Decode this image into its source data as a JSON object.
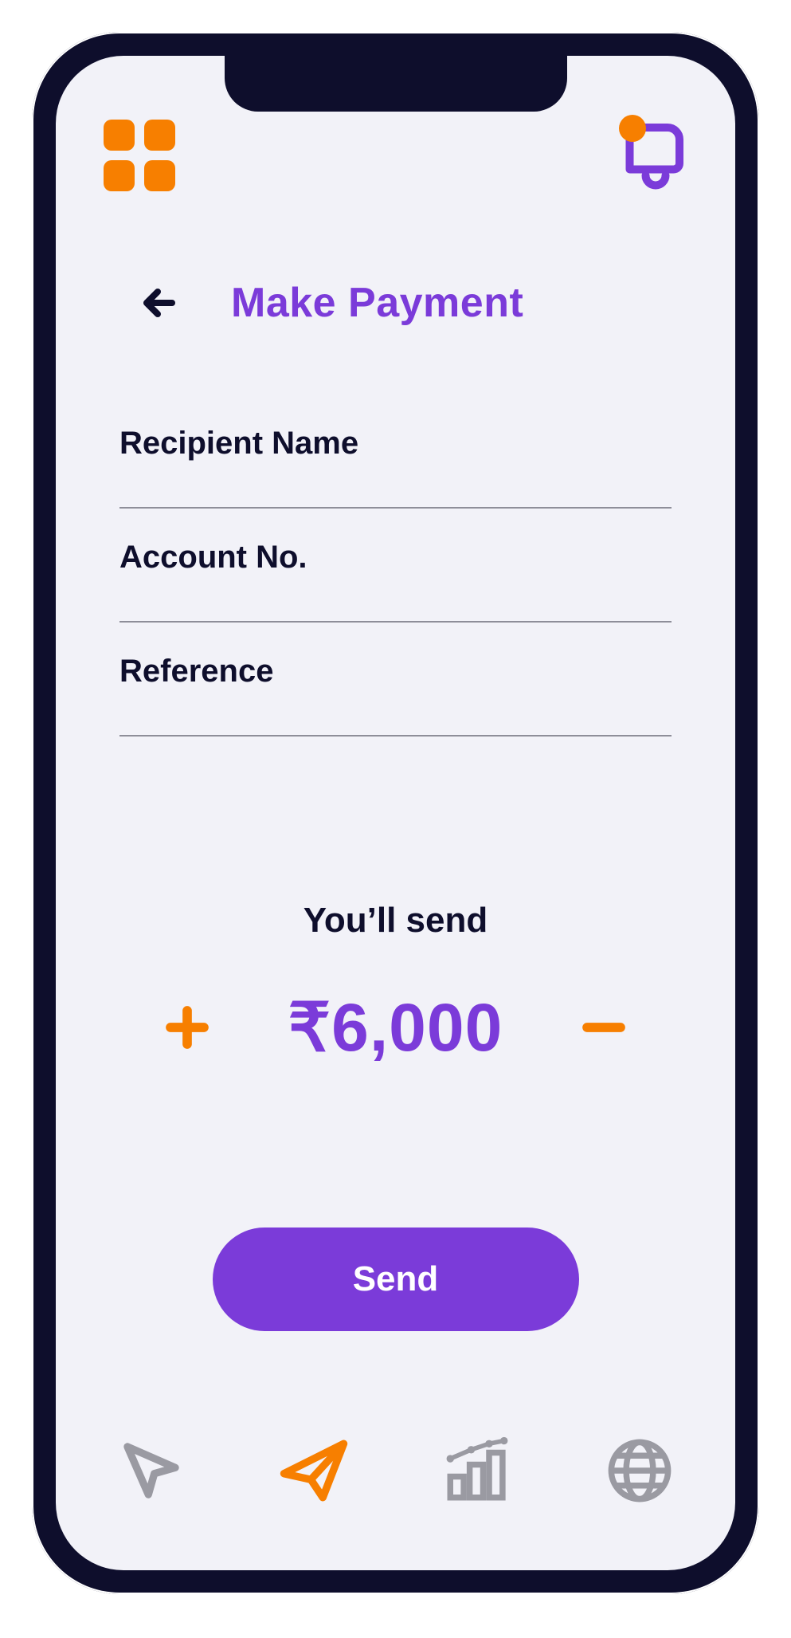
{
  "colors": {
    "accent_purple": "#7b3bd9",
    "accent_orange": "#f77f00",
    "text_dark": "#0e0e2c",
    "muted_gray": "#9a9aa2",
    "screen_bg": "#f2f2f8"
  },
  "header": {
    "menu_icon": "grid-menu-icon",
    "notification_icon": "bell-icon",
    "notification_badge": true,
    "back_icon": "arrow-left-icon",
    "title": "Make Payment"
  },
  "form": {
    "fields": [
      {
        "label": "Recipient Name",
        "value": ""
      },
      {
        "label": "Account No.",
        "value": ""
      },
      {
        "label": "Reference",
        "value": ""
      }
    ]
  },
  "amount": {
    "label": "You’ll send",
    "display": "₹6,000",
    "currency": "₹",
    "value": 6000,
    "increase_icon": "plus-icon",
    "decrease_icon": "minus-icon"
  },
  "actions": {
    "send_label": "Send"
  },
  "bottom_nav": {
    "items": [
      {
        "icon": "cursor-icon",
        "active": false
      },
      {
        "icon": "paper-plane-icon",
        "active": true
      },
      {
        "icon": "bar-chart-icon",
        "active": false
      },
      {
        "icon": "globe-icon",
        "active": false
      }
    ]
  }
}
